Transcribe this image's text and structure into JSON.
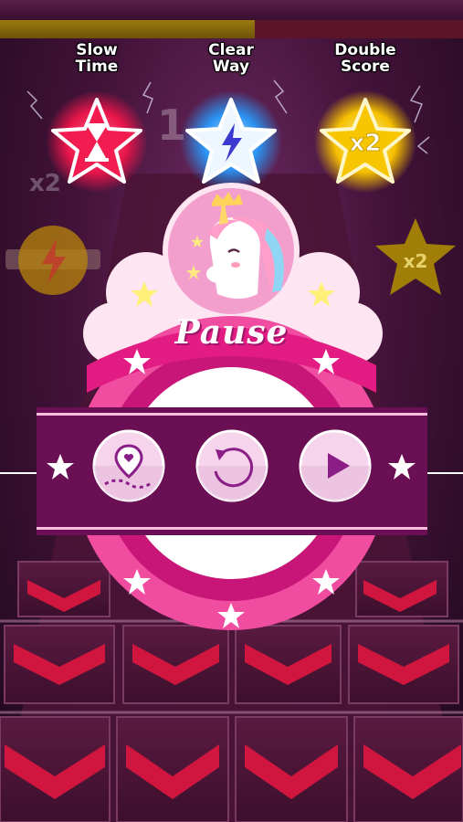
{
  "hud": {
    "progress": 0.55
  },
  "powerups": [
    {
      "label": "Slow\nTime",
      "icon": "hourglass-icon",
      "color": "#e8154a"
    },
    {
      "label": "Clear\nWay",
      "icon": "lightning-icon",
      "color": "#1e8cf0"
    },
    {
      "label": "Double\nScore",
      "icon": "x2-icon",
      "color": "#f0b400"
    }
  ],
  "pause_menu": {
    "title": "Pause",
    "buttons": [
      {
        "name": "map-button",
        "icon": "map-pin-icon"
      },
      {
        "name": "restart-button",
        "icon": "restart-icon"
      },
      {
        "name": "resume-button",
        "icon": "play-icon"
      }
    ],
    "mascot": "unicorn-icon"
  },
  "colors": {
    "accent_pink": "#ee2a8c",
    "dark_purple": "#6b0f55",
    "light_pink": "#f9c8e2"
  }
}
